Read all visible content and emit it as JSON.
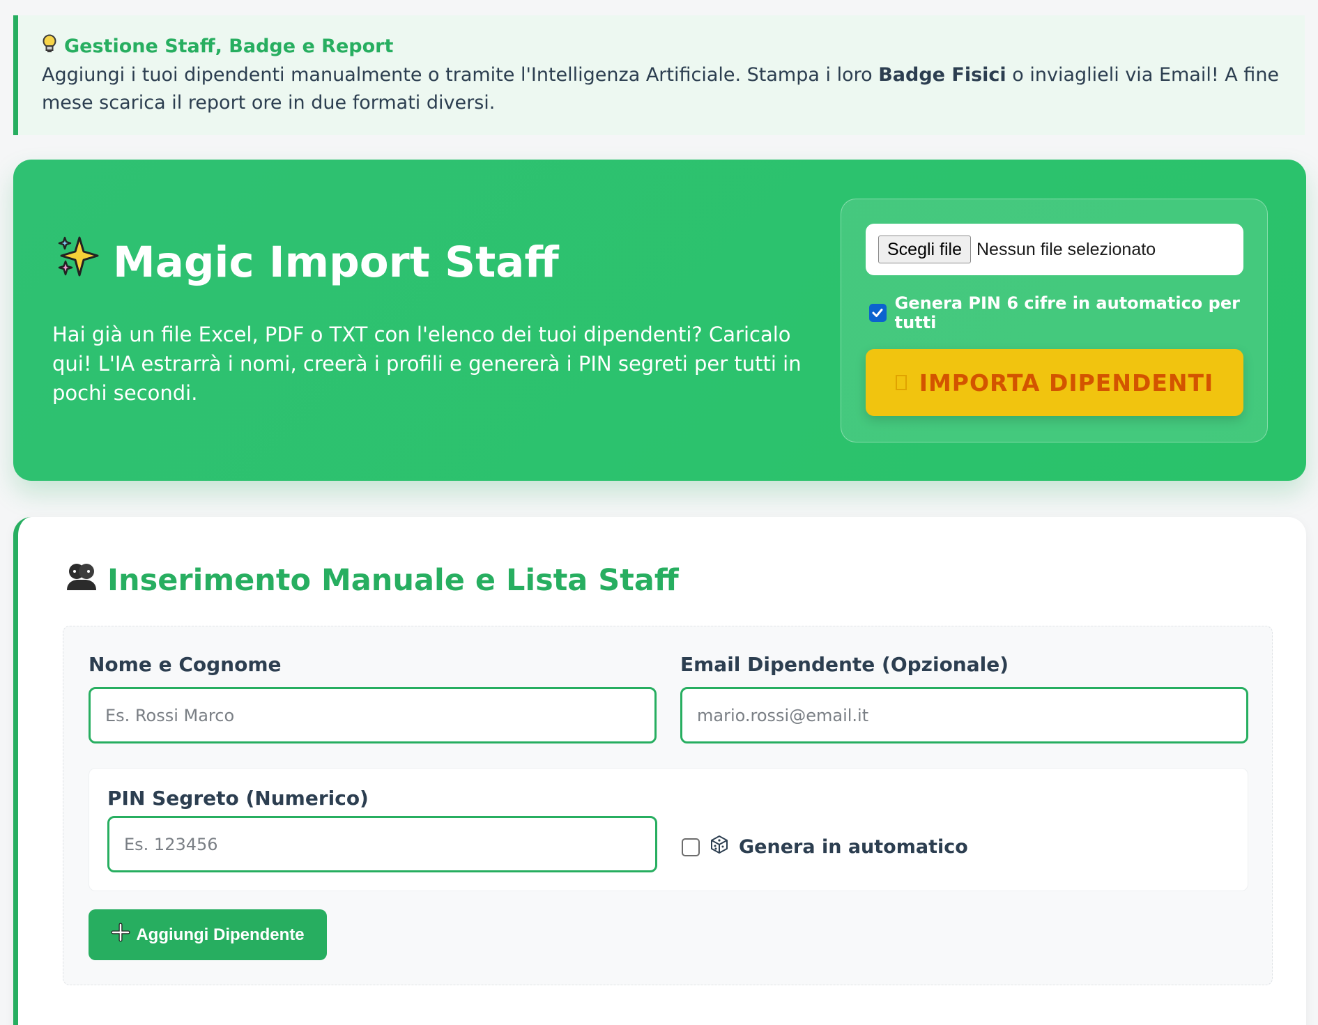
{
  "info": {
    "icon": "lightbulb-icon",
    "title": "Gestione Staff, Badge e Report",
    "text_before": "Aggiungi i tuoi dipendenti manualmente o tramite l'Intelligenza Artificiale. Stampa i loro ",
    "text_bold": "Badge Fisici",
    "text_after": " o inviaglieli via Email! A fine mese scarica il report ore in due formati diversi."
  },
  "magic_import": {
    "icon": "sparkles-icon",
    "title": "Magic Import Staff",
    "description": "Hai già un file Excel, PDF o TXT con l'elenco dei tuoi dipendenti? Caricalo qui! L'IA estrarrà i nomi, creerà i profili e genererà i PIN segreti per tutti in pochi secondi.",
    "file_button_label": "Scegli file",
    "file_status": "Nessun file selezionato",
    "auto_pin_label": "Genera PIN 6 cifre in automatico per tutti",
    "auto_pin_checked": true,
    "import_button_label": "IMPORTA DIPENDENTI"
  },
  "manual": {
    "icon": "people-icon",
    "title": "Inserimento Manuale e Lista Staff",
    "name_label": "Nome e Cognome",
    "name_placeholder": "Es. Rossi Marco",
    "email_label": "Email Dipendente (Opzionale)",
    "email_placeholder": "mario.rossi@email.it",
    "pin_label": "PIN Segreto (Numerico)",
    "pin_placeholder": "Es. 123456",
    "auto_gen_label": "Genera in automatico",
    "auto_gen_icon": "dice-icon",
    "auto_gen_checked": false,
    "add_button_label": "Aggiungi Dipendente",
    "add_button_icon": "plus-icon"
  },
  "colors": {
    "accent": "#27ae60",
    "banner": "#2ec06e",
    "import_button": "#f1c40f",
    "import_text": "#d35400",
    "text_dark": "#2c3e50"
  }
}
